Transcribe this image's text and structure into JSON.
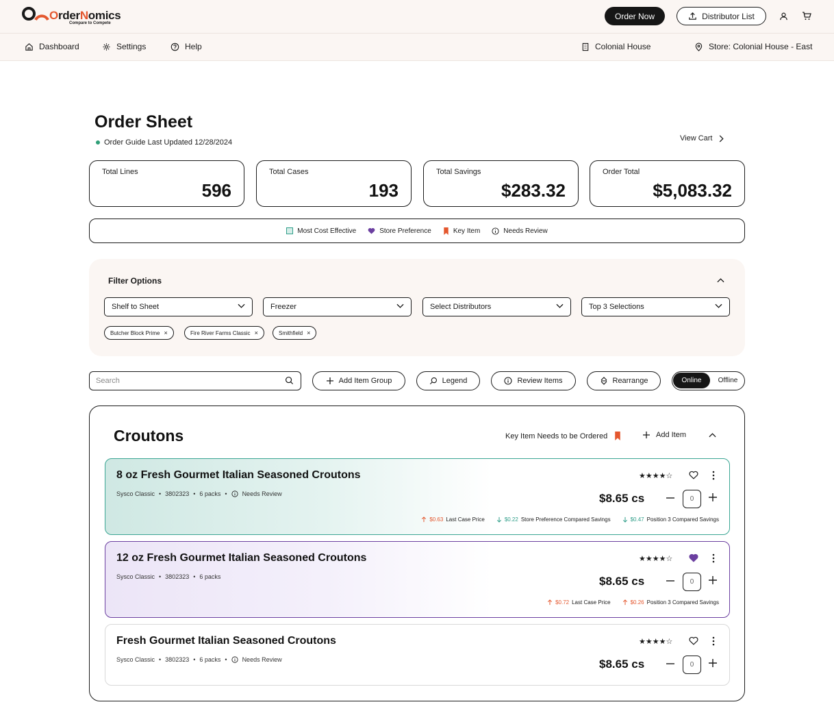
{
  "app": {
    "logo_text": {
      "o": "O",
      "rder": "rder",
      "n": "N",
      "omics": "omics"
    },
    "tagline": "Compare to Compete",
    "brand_color": "#e4572e"
  },
  "header": {
    "order_now": "Order Now",
    "distributor_list": "Distributor List"
  },
  "nav": {
    "dashboard": "Dashboard",
    "settings": "Settings",
    "help": "Help",
    "org": "Colonial House",
    "store": "Store: Colonial House - East"
  },
  "page": {
    "title": "Order Sheet",
    "updated": "Order Guide Last Updated 12/28/2024",
    "view_cart": "View Cart"
  },
  "stats": [
    {
      "label": "Total Lines",
      "value": "596"
    },
    {
      "label": "Total Cases",
      "value": "193"
    },
    {
      "label": "Total Savings",
      "value": "$283.32"
    },
    {
      "label": "Order Total",
      "value": "$5,083.32"
    }
  ],
  "legend": {
    "most_cost_effective": "Most Cost Effective",
    "store_preference": "Store Preference",
    "key_item": "Key Item",
    "needs_review": "Needs Review",
    "colors": {
      "teal": "#2f9e89",
      "purple": "#6b3fa0",
      "orange": "#e4572e"
    }
  },
  "filter": {
    "title": "Filter Options",
    "selects": [
      "Shelf to Sheet",
      "Freezer",
      "Select Distributors",
      "Top 3 Selections"
    ],
    "chips": [
      "Butcher Block Prime",
      "Fire River Farms Classic",
      "Smithfield"
    ]
  },
  "toolbar": {
    "search_placeholder": "Search",
    "add_item_group": "Add Item Group",
    "legend": "Legend",
    "review_items": "Review Items",
    "rearrange": "Rearrange",
    "online": "Online",
    "offline": "Offline"
  },
  "group": {
    "title": "Croutons",
    "key_item_note": "Key Item Needs to be Ordered",
    "add_item": "Add Item",
    "items": [
      {
        "title": "8 oz Fresh Gourmet Italian Seasoned Croutons",
        "brand": "Sysco Classic",
        "sku": "3802323",
        "pack": "6 packs",
        "review": "Needs Review",
        "rating": 4,
        "price": "$8.65 cs",
        "qty": "0",
        "metrics": [
          {
            "dir": "up",
            "amount": "$0.63",
            "label": "Last Case Price"
          },
          {
            "dir": "down",
            "amount": "$0.22",
            "label": "Store Preference Compared Savings"
          },
          {
            "dir": "down",
            "amount": "$0.47",
            "label": "Position 3 Compared Savings"
          }
        ]
      },
      {
        "title": "12 oz Fresh Gourmet Italian Seasoned Croutons",
        "brand": "Sysco Classic",
        "sku": "3802323",
        "pack": "6 packs",
        "rating": 4,
        "price": "$8.65 cs",
        "qty": "0",
        "metrics": [
          {
            "dir": "up",
            "amount": "$0.72",
            "label": "Last Case Price"
          },
          {
            "dir": "up",
            "amount": "$0.26",
            "label": "Position 3 Compared Savings"
          }
        ]
      },
      {
        "title": "Fresh Gourmet Italian Seasoned Croutons",
        "brand": "Sysco Classic",
        "sku": "3802323",
        "pack": "6 packs",
        "review": "Needs Review",
        "rating": 4,
        "price": "$8.65 cs",
        "qty": "0"
      }
    ]
  },
  "glyphs": {
    "bullet": "•",
    "close": "×",
    "star_full": "★",
    "star_empty": "☆"
  }
}
